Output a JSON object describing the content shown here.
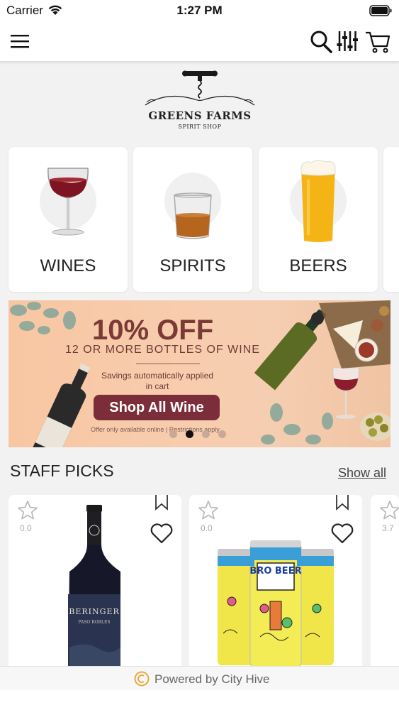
{
  "status_bar": {
    "carrier": "Carrier",
    "time": "1:27 PM"
  },
  "nav": {
    "icons": [
      "menu-icon",
      "search-icon",
      "filter-icon",
      "cart-icon"
    ]
  },
  "logo": {
    "title": "GREENS FARMS",
    "subtitle": "SPIRIT SHOP"
  },
  "categories": [
    {
      "label": "WINES",
      "icon": "wine-glass-icon"
    },
    {
      "label": "SPIRITS",
      "icon": "whiskey-glass-icon"
    },
    {
      "label": "BEERS",
      "icon": "beer-glass-icon"
    }
  ],
  "promo": {
    "headline": "10% OFF",
    "subheadline": "12 OR MORE BOTTLES OF WINE",
    "note": "Savings automatically applied in cart",
    "button_label": "Shop All Wine",
    "fine_print": "Offer only available online | Restrictions apply.",
    "slide_count": 4,
    "active_slide": 2
  },
  "staff_picks": {
    "title": "STAFF PICKS",
    "show_all_label": "Show all",
    "products": [
      {
        "rating": "0.0",
        "image": "beringer-wine-bottle",
        "bottle_brand": "BERINGER",
        "bottle_region": "PASO ROBLES"
      },
      {
        "rating": "0.0",
        "image": "bro-beer-cans",
        "can_label": "BRO BEER"
      },
      {
        "rating": "3.7"
      }
    ]
  },
  "footer": {
    "powered_by": "Powered by City Hive"
  },
  "colors": {
    "promo_button": "#7b2e3a",
    "promo_text": "#7a3a36",
    "background": "#f2f2f3"
  }
}
